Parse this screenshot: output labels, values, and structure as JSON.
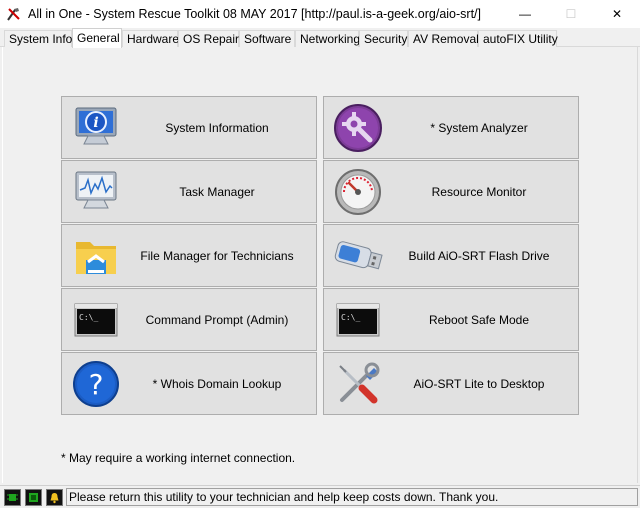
{
  "window": {
    "title": "All in One - System Rescue Toolkit 08 MAY 2017 [http://paul.is-a-geek.org/aio-srt/]",
    "minimize": "—",
    "maximize": "☐",
    "close": "✕"
  },
  "tabs": [
    {
      "label": "System Info"
    },
    {
      "label": "General"
    },
    {
      "label": "Hardware"
    },
    {
      "label": "OS Repair"
    },
    {
      "label": "Software"
    },
    {
      "label": "Networking"
    },
    {
      "label": "Security"
    },
    {
      "label": "AV Removal"
    },
    {
      "label": "autoFIX Utility"
    }
  ],
  "active_tab": "General",
  "buttons": [
    {
      "label": "System Information",
      "icon": "monitor-info-icon"
    },
    {
      "label": "* System Analyzer",
      "icon": "gear-wrench-icon"
    },
    {
      "label": "Task Manager",
      "icon": "monitor-graph-icon"
    },
    {
      "label": "Resource Monitor",
      "icon": "gauge-icon"
    },
    {
      "label": "File Manager for Technicians",
      "icon": "folder-icon"
    },
    {
      "label": "Build AiO-SRT Flash Drive",
      "icon": "usb-drive-icon"
    },
    {
      "label": "Command Prompt (Admin)",
      "icon": "command-prompt-icon"
    },
    {
      "label": "Reboot Safe Mode",
      "icon": "command-prompt-icon"
    },
    {
      "label": "* Whois Domain Lookup",
      "icon": "question-mark-icon"
    },
    {
      "label": "AiO-SRT Lite to Desktop",
      "icon": "screwdriver-wrench-icon"
    }
  ],
  "footnote": "* May require a working internet connection.",
  "status": {
    "message": "Please return this utility to your technician and help keep costs down. Thank you."
  }
}
